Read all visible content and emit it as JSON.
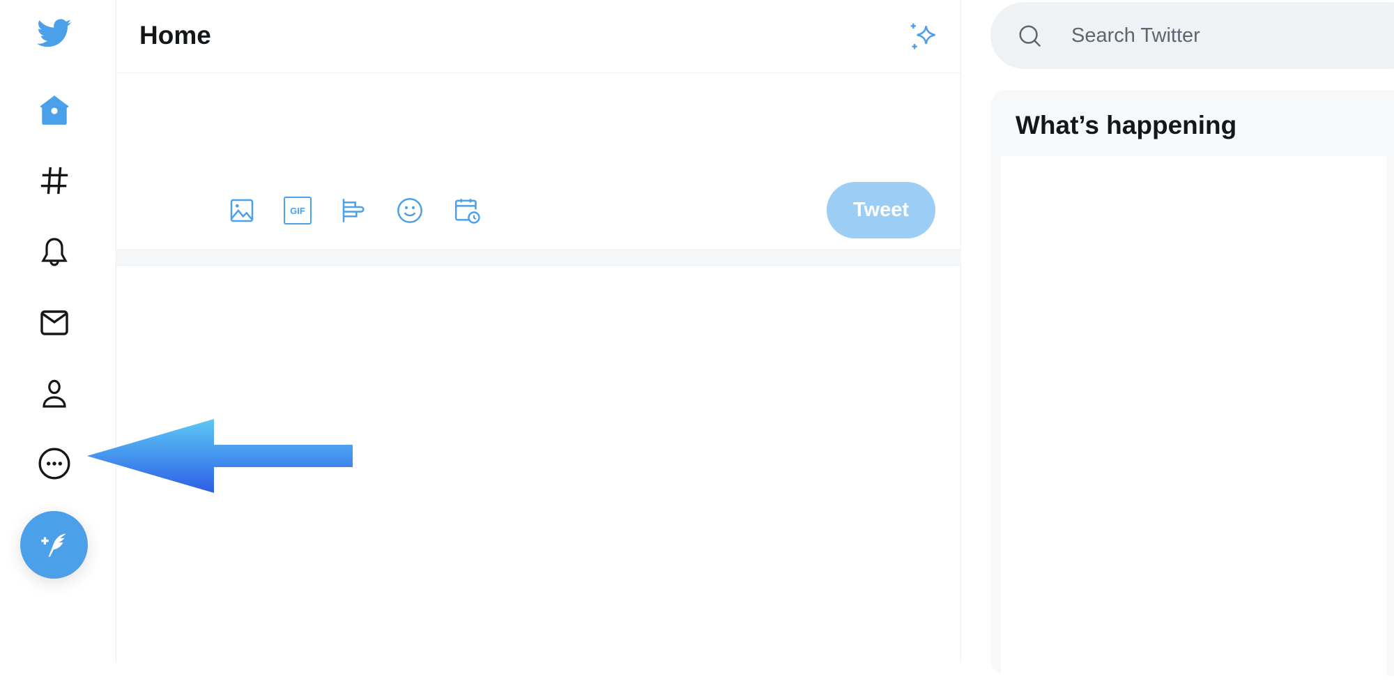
{
  "sidebar": {
    "items": [
      {
        "name": "twitter-logo",
        "label": ""
      },
      {
        "name": "home",
        "label": ""
      },
      {
        "name": "explore",
        "label": ""
      },
      {
        "name": "notifications",
        "label": ""
      },
      {
        "name": "messages",
        "label": ""
      },
      {
        "name": "profile",
        "label": ""
      },
      {
        "name": "more",
        "label": ""
      }
    ],
    "compose_icon": "feather-plus-icon"
  },
  "header": {
    "title": "Home",
    "sparkle_icon": "sparkle-icon"
  },
  "composer": {
    "tools": [
      "image-icon",
      "gif-icon",
      "poll-icon",
      "emoji-icon",
      "schedule-icon"
    ],
    "gif_label": "GIF",
    "tweet_label": "Tweet"
  },
  "search": {
    "placeholder": "Search Twitter"
  },
  "trends": {
    "title": "What’s happening"
  },
  "annotation": {
    "type": "arrow",
    "points_to": "more",
    "gradient": [
      "#5cc9f5",
      "#2e5ee6"
    ]
  },
  "colors": {
    "accent": "#4c9fe9",
    "tweet_disabled": "#9ccdf4",
    "search_bg": "#eef2f4"
  }
}
